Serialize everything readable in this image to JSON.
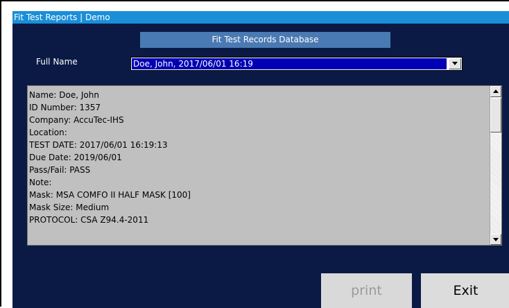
{
  "window": {
    "title": "Fit Test Reports | Demo"
  },
  "banner": {
    "title": "Fit Test Records Database"
  },
  "selector": {
    "label": "Full Name",
    "selected_value": "Doe, John, 2017/06/01 16:19"
  },
  "record": {
    "lines": [
      "Name: Doe, John",
      "ID Number: 1357",
      "Company: AccuTec-IHS",
      "Location:",
      "TEST DATE: 2017/06/01 16:19:13",
      "Due Date: 2019/06/01",
      "Pass/Fail: PASS",
      "Note:",
      "Mask: MSA COMFO II HALF MASK [100]",
      "Mask Size: Medium",
      "PROTOCOL: CSA Z94.4-2011"
    ]
  },
  "buttons": {
    "print_label": "print",
    "exit_label": "Exit"
  },
  "colors": {
    "background": "#0b1a45",
    "titlebar": "#1a8fd8",
    "banner": "#4a7ab3",
    "selection": "#0000b4",
    "textbox": "#c0c0c0"
  }
}
